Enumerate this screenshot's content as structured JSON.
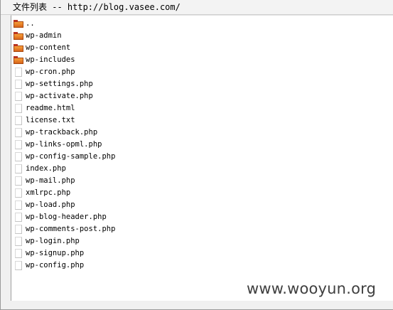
{
  "window": {
    "title_label": "文件列表 -- ",
    "url": "http://blog.vasee.com/"
  },
  "files": [
    {
      "name": "..",
      "type": "folder"
    },
    {
      "name": "wp-admin",
      "type": "folder"
    },
    {
      "name": "wp-content",
      "type": "folder"
    },
    {
      "name": "wp-includes",
      "type": "folder"
    },
    {
      "name": "wp-cron.php",
      "type": "file"
    },
    {
      "name": "wp-settings.php",
      "type": "file"
    },
    {
      "name": "wp-activate.php",
      "type": "file"
    },
    {
      "name": "readme.html",
      "type": "file"
    },
    {
      "name": "license.txt",
      "type": "file"
    },
    {
      "name": "wp-trackback.php",
      "type": "file"
    },
    {
      "name": "wp-links-opml.php",
      "type": "file"
    },
    {
      "name": "wp-config-sample.php",
      "type": "file"
    },
    {
      "name": "index.php",
      "type": "file"
    },
    {
      "name": "wp-mail.php",
      "type": "file"
    },
    {
      "name": "xmlrpc.php",
      "type": "file"
    },
    {
      "name": "wp-load.php",
      "type": "file"
    },
    {
      "name": "wp-blog-header.php",
      "type": "file"
    },
    {
      "name": "wp-comments-post.php",
      "type": "file"
    },
    {
      "name": "wp-login.php",
      "type": "file"
    },
    {
      "name": "wp-signup.php",
      "type": "file"
    },
    {
      "name": "wp-config.php",
      "type": "file"
    }
  ],
  "icons": {
    "folder": "folder-icon",
    "file": "file-icon"
  },
  "watermark": "www.wooyun.org"
}
